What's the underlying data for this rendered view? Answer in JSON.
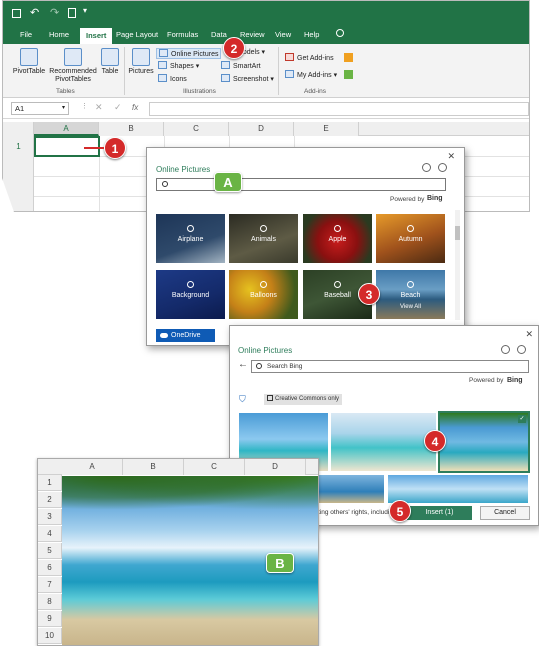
{
  "excel": {
    "tabs": [
      "File",
      "Home",
      "Insert",
      "Page Layout",
      "Formulas",
      "Data",
      "Review",
      "View",
      "Help"
    ],
    "tables_group": {
      "buttons": [
        "PivotTable",
        "Recommended PivotTables",
        "Table"
      ],
      "label": "Tables"
    },
    "illustrations": {
      "pictures": "Pictures",
      "online_pictures": "Online Pictures",
      "shapes": "Shapes",
      "icons": "Icons",
      "models": "Models",
      "smartart": "SmartArt",
      "screenshot": "Screenshot",
      "label": "Illustrations"
    },
    "addins": {
      "get": "Get Add-ins",
      "my": "My Add-ins",
      "label": "Add-ins"
    },
    "namebox": "A1",
    "fx": "fx",
    "columns": [
      "A",
      "B",
      "C",
      "D",
      "E"
    ],
    "row1": "1"
  },
  "dialog1": {
    "title": "Online Pictures",
    "powered": "Powered by",
    "bing": "Bing",
    "tiles": [
      "Airplane",
      "Animals",
      "Apple",
      "Autumn",
      "Background",
      "Balloons",
      "Baseball",
      "Beach"
    ],
    "view_all": "View All",
    "onedrive": "OneDrive"
  },
  "dialog2": {
    "title": "Online Pictures",
    "search_placeholder": "Search Bing",
    "powered": "Powered by",
    "bing": "Bing",
    "creative_commons": "Creative Commons only",
    "rights_text": "ting others' rights, includi",
    "insert": "Insert (1)",
    "cancel": "Cancel"
  },
  "sheet2": {
    "columns": [
      "A",
      "B",
      "C",
      "D"
    ],
    "rows": [
      "1",
      "2",
      "3",
      "4",
      "5",
      "6",
      "7",
      "8",
      "9",
      "10"
    ]
  },
  "callouts": {
    "one": "1",
    "two": "2",
    "three": "3",
    "four": "4",
    "five": "5",
    "a": "A",
    "b": "B"
  },
  "colors": {
    "excel_green": "#217346",
    "callout_red": "#d42a2a",
    "callout_green": "#6ab445",
    "onedrive_blue": "#0f5bb5"
  }
}
